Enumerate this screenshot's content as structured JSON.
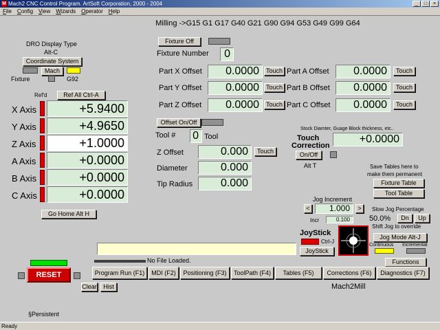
{
  "window": {
    "title": "Mach2 CNC Control Program. ArtSoft Corporation, 2000 - 2004",
    "icon_letter": "M",
    "controls": [
      "_",
      "□",
      "×"
    ]
  },
  "menu": [
    "File",
    "Config",
    "View",
    "Wizards",
    "Operator",
    "Help"
  ],
  "gcode_line": "Milling ->G15  G1 G17 G40 G21 G90 G94 G53 G49 G99 G64",
  "dro_display": {
    "type_label": "DRO Display Type",
    "hotkey": "Alt-C",
    "coord_button": "Coordinate System",
    "mach_button": "Mach",
    "fixture_label": "Fixture",
    "g92_label": "G92"
  },
  "refd_label": "Ref'd",
  "ref_all_button": "Ref All Ctrl-A",
  "axes": [
    {
      "label": "X Axis",
      "value": "+5.9400",
      "ref": "red",
      "highlight": false
    },
    {
      "label": "Y Axis",
      "value": "+4.9650",
      "ref": "red",
      "highlight": false
    },
    {
      "label": "Z Axis",
      "value": "+1.0000",
      "ref": "red",
      "highlight": true
    },
    {
      "label": "A Axis",
      "value": "+0.0000",
      "ref": "red",
      "highlight": false
    },
    {
      "label": "B Axis",
      "value": "+0.0000",
      "ref": "red",
      "highlight": false
    },
    {
      "label": "C Axis",
      "value": "+0.0000",
      "ref": "red",
      "highlight": false
    }
  ],
  "go_home_button": "Go Home Alt H",
  "fixture": {
    "off_button": "Fixture Off",
    "number_label": "Fixture Number",
    "number_value": "0"
  },
  "offsets_left": [
    {
      "label": "Part X Offset",
      "value": "0.0000",
      "touch": "Touch"
    },
    {
      "label": "Part Y Offset",
      "value": "0.0000",
      "touch": "Touch"
    },
    {
      "label": "Part Z Offset",
      "value": "0.0000",
      "touch": "Touch"
    }
  ],
  "offsets_right": [
    {
      "label": "Part A Offset",
      "value": "0.0000",
      "touch": "Touch"
    },
    {
      "label": "Part B Offset",
      "value": "0.0000",
      "touch": "Touch"
    },
    {
      "label": "Part C Offset",
      "value": "0.0000",
      "touch": "Touch"
    }
  ],
  "tool": {
    "offset_button": "Offset On/Off",
    "tool_hash_label": "Tool #",
    "tool_number": "0",
    "tool_label": "Tool",
    "z_offset_label": "Z Offset",
    "z_offset_value": "0.000",
    "z_touch": "Touch",
    "diameter_label": "Diameter",
    "diameter_value": "0.000",
    "tip_radius_label": "Tip Radius",
    "tip_radius_value": "0.000"
  },
  "touch_correction": {
    "note": "Stock Diamter, Guage Block thickness, etc..",
    "label_line1": "Touch",
    "label_line2": "Correction",
    "value": "+0.0000",
    "onoff_button": "On/Off",
    "alt": "Alt T"
  },
  "tables": {
    "note_line1": "Save Tables here to",
    "note_line2": "make them permanent",
    "fixture_button": "Fixture Table",
    "tool_button": "Tool Table"
  },
  "jog": {
    "increment_label": "Jog Increment",
    "increment_value": "1.000",
    "prev": "<",
    "next": ">",
    "incr_label": "Incr",
    "incr_value": "0.100",
    "slow_label": "Slow Jog Percentage",
    "slow_value": "50.0%",
    "dn_button": "Dn",
    "up_button": "Up",
    "shift_note": "Shift Jog to override",
    "mode_button": "Jog Mode Alt-J",
    "continuous_label": "Continuous",
    "incremental_label": "Incremental"
  },
  "joystick": {
    "title": "JoyStick",
    "ctrl": "Ctrl-J",
    "button": "JoyStick"
  },
  "file_status": "No File Loaded.",
  "reset_button": "RESET",
  "clear_button": "Clear",
  "hist_button": "Hist",
  "functions_button": "Functions",
  "tabs": [
    "Program Run (F1)",
    "MDI (F2)",
    "Positioning (F3)",
    "ToolPath (F4)",
    "Tables (F5)",
    "Corrections (F6)",
    "Diagnostics (F7)"
  ],
  "app_name": "Mach2Mill",
  "persistent_label": "§Persistent",
  "status_text": "Ready",
  "colors": {
    "title_start": "#0a246a",
    "dro_bg": "#d8ecd8",
    "led_red": "#e00000",
    "led_yellow": "#ffff00",
    "reset_red": "#cc0000",
    "mdi_bg": "#ffffd0"
  }
}
